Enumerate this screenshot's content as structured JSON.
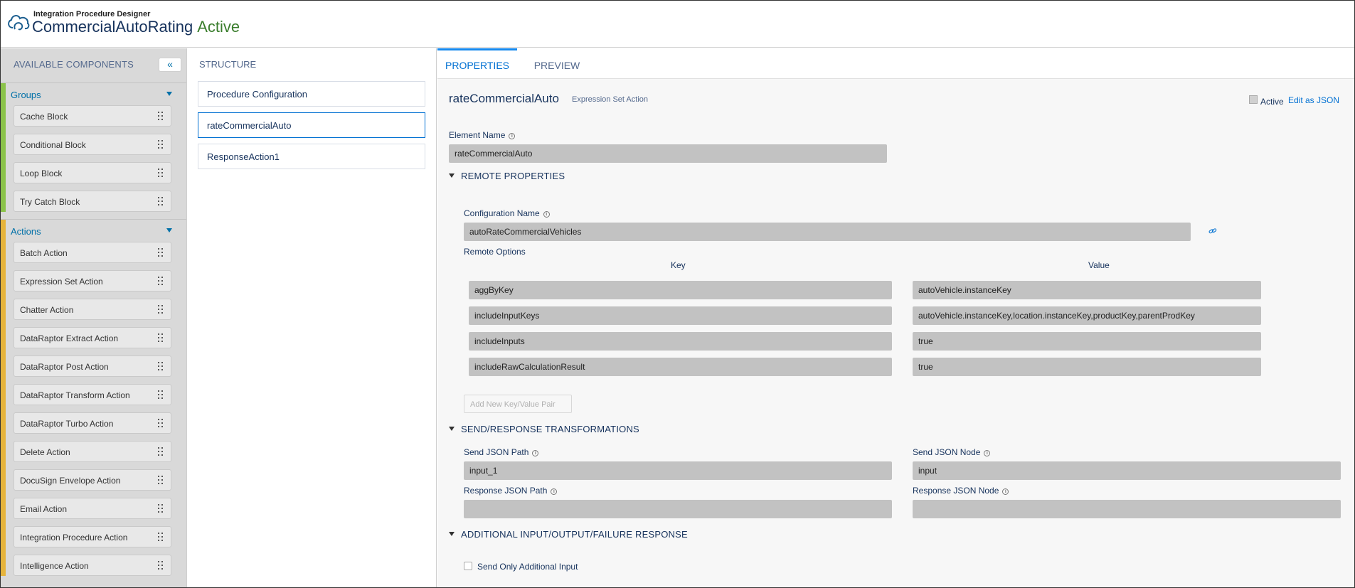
{
  "header": {
    "subtitle": "Integration Procedure Designer",
    "title": "CommercialAutoRating",
    "status": "Active"
  },
  "sidebar": {
    "title": "AVAILABLE COMPONENTS",
    "collapse_label": "«",
    "groups": {
      "label": "Groups",
      "accent": "#8bc34a",
      "items": [
        "Cache Block",
        "Conditional Block",
        "Loop Block",
        "Try Catch Block"
      ]
    },
    "actions": {
      "label": "Actions",
      "accent": "#e6b43c",
      "items": [
        "Batch Action",
        "Expression Set Action",
        "Chatter Action",
        "DataRaptor Extract Action",
        "DataRaptor Post Action",
        "DataRaptor Transform Action",
        "DataRaptor Turbo Action",
        "Delete Action",
        "DocuSign Envelope Action",
        "Email Action",
        "Integration Procedure Action",
        "Intelligence Action"
      ]
    }
  },
  "structure": {
    "title": "STRUCTURE",
    "nodes": [
      "Procedure Configuration",
      "rateCommercialAuto",
      "ResponseAction1"
    ]
  },
  "properties": {
    "tabs": [
      "PROPERTIES",
      "PREVIEW"
    ],
    "element_title": "rateCommercialAuto",
    "element_type": "Expression Set Action",
    "active_label": "Active",
    "edit_json_label": "Edit as JSON",
    "element_name_label": "Element Name",
    "element_name_value": "rateCommercialAuto",
    "remote_section": "REMOTE PROPERTIES",
    "config_name_label": "Configuration Name",
    "config_name_value": "autoRateCommercialVehicles",
    "remote_options_label": "Remote Options",
    "key_header": "Key",
    "value_header": "Value",
    "options": [
      {
        "key": "aggByKey",
        "value": "autoVehicle.instanceKey"
      },
      {
        "key": "includeInputKeys",
        "value": "autoVehicle.instanceKey,location.instanceKey,productKey,parentProdKey"
      },
      {
        "key": "includeInputs",
        "value": "true"
      },
      {
        "key": "includeRawCalculationResult",
        "value": "true"
      }
    ],
    "add_pair_label": "Add New Key/Value Pair",
    "transform_section": "SEND/RESPONSE TRANSFORMATIONS",
    "send_path_label": "Send JSON Path",
    "send_path_value": "input_1",
    "send_node_label": "Send JSON Node",
    "send_node_value": "input",
    "response_path_label": "Response JSON Path",
    "response_path_value": "",
    "response_node_label": "Response JSON Node",
    "response_node_value": "",
    "additional_section": "ADDITIONAL INPUT/OUTPUT/FAILURE RESPONSE",
    "send_only_label": "Send Only Additional Input"
  },
  "icons": {
    "logo": "cloud-logo-icon",
    "info": "info-icon",
    "grip": "drag-handle-icon",
    "link": "link-icon"
  }
}
